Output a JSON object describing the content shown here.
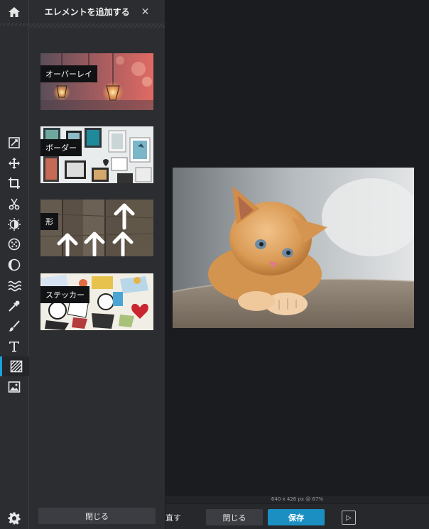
{
  "panel": {
    "title": "エレメントを追加する",
    "close_symbol": "✕",
    "items": [
      {
        "label": "オーバーレイ"
      },
      {
        "label": "ボーダー"
      },
      {
        "label": "形"
      },
      {
        "label": "ステッカー"
      }
    ],
    "close_button": "閉じる"
  },
  "toolbar": {
    "icons": [
      "home-icon",
      "edit-icon",
      "move-icon",
      "crop-icon",
      "cut-icon",
      "adjust-icon",
      "filter-icon",
      "vignette-icon",
      "wave-icon",
      "dropper-icon",
      "brush-icon",
      "text-icon",
      "pattern-icon",
      "image-icon",
      "settings-icon"
    ],
    "active": "pattern-icon"
  },
  "status": {
    "text": "640 x 426 px @ 67%"
  },
  "bottom": {
    "redo_label": "直す",
    "close_label": "閉じる",
    "save_label": "保存",
    "panel_toggle": "▷"
  },
  "colors": {
    "accent": "#1b8fc2",
    "active_marker": "#1da1d6"
  }
}
